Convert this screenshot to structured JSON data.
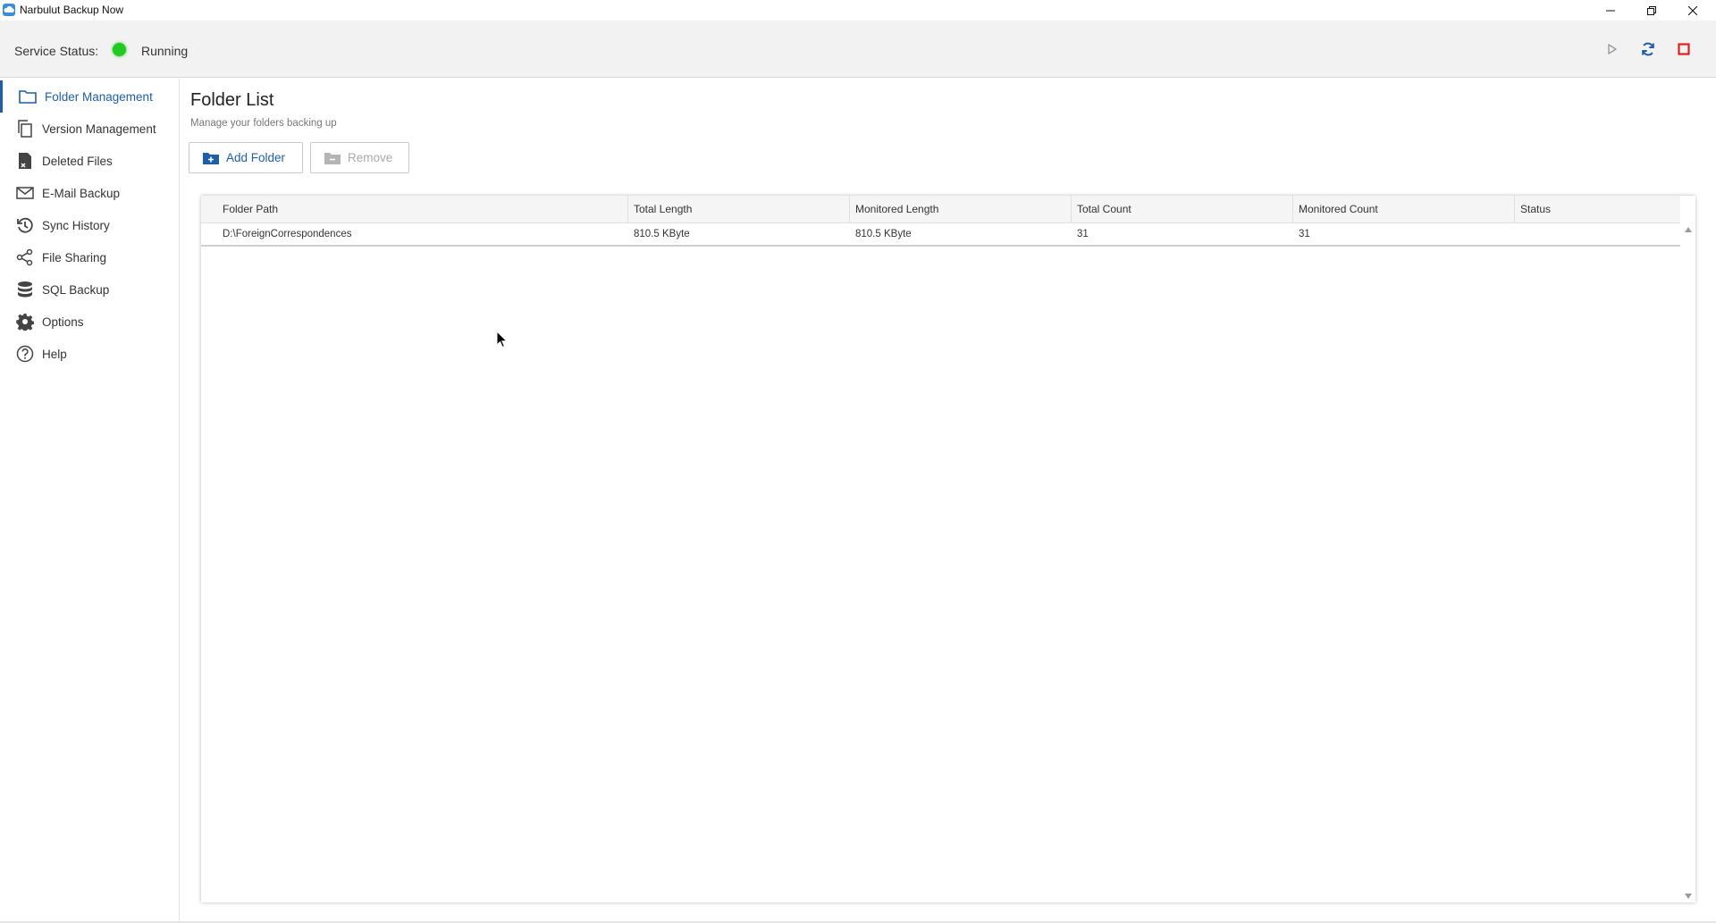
{
  "window": {
    "title": "Narbulut Backup Now",
    "icon": "cloud-app-icon"
  },
  "service": {
    "label": "Service Status:",
    "status": "Running",
    "status_color": "#22c922",
    "controls": [
      "play-icon",
      "refresh-icon",
      "stop-icon"
    ]
  },
  "sidebar": {
    "items": [
      {
        "label": "Folder Management",
        "icon": "folder-icon",
        "active": true
      },
      {
        "label": "Version Management",
        "icon": "versions-icon",
        "active": false
      },
      {
        "label": "Deleted Files",
        "icon": "deleted-file-icon",
        "active": false
      },
      {
        "label": "E-Mail Backup",
        "icon": "mail-icon",
        "active": false
      },
      {
        "label": "Sync History",
        "icon": "history-icon",
        "active": false
      },
      {
        "label": "File Sharing",
        "icon": "share-icon",
        "active": false
      },
      {
        "label": "SQL Backup",
        "icon": "database-icon",
        "active": false
      },
      {
        "label": "Options",
        "icon": "gear-icon",
        "active": false
      },
      {
        "label": "Help",
        "icon": "help-icon",
        "active": false
      }
    ]
  },
  "main": {
    "title": "Folder List",
    "subtitle": "Manage your folders backing up",
    "add_button": "Add Folder",
    "remove_button": "Remove",
    "accent_color": "#1f5fa8"
  },
  "table": {
    "columns": [
      "Folder Path",
      "Total Length",
      "Monitored Length",
      "Total Count",
      "Monitored Count",
      "Status"
    ],
    "rows": [
      [
        "D:\\ForeignCorrespondences",
        "810.5 KByte",
        "810.5 KByte",
        "31",
        "31",
        ""
      ]
    ]
  }
}
